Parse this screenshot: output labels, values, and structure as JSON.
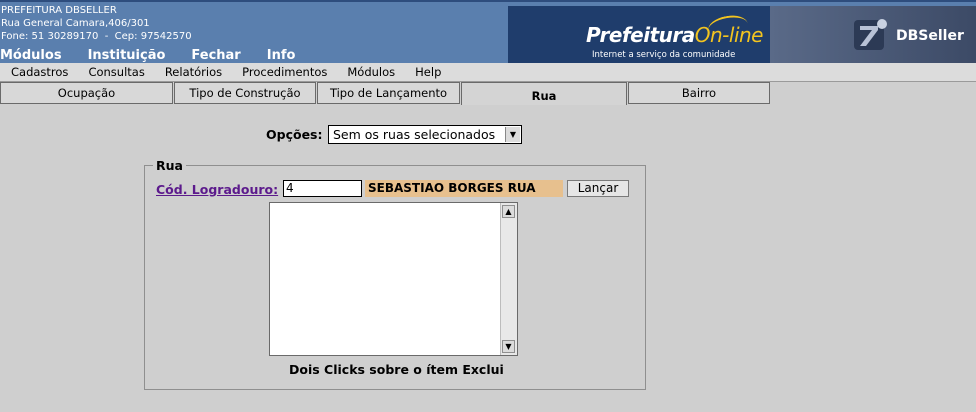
{
  "header": {
    "org_name": "PREFEITURA DBSELLER",
    "address": "Rua General Camara,406/301",
    "contact": "Fone: 51 30289170  -  Cep: 97542570",
    "nav": [
      "Módulos",
      "Instituição",
      "Fechar",
      "Info"
    ],
    "banner_title_1": "Prefeitura",
    "banner_title_2": "On-line",
    "banner_tagline": "Internet a serviço da comunidade",
    "dbseller_brand": "DBSeller"
  },
  "menubar": [
    "Cadastros",
    "Consultas",
    "Relatórios",
    "Procedimentos",
    "Módulos",
    "Help"
  ],
  "tabs": [
    {
      "label": "Ocupação",
      "active": false
    },
    {
      "label": "Tipo de Construção",
      "active": false
    },
    {
      "label": "Tipo de Lançamento",
      "active": false
    },
    {
      "label": "Rua",
      "active": true
    },
    {
      "label": "Bairro",
      "active": false
    }
  ],
  "form": {
    "opcoes_label": "Opções:",
    "opcoes_value": "Sem os ruas selecionados",
    "fieldset_legend": "Rua",
    "cod_label": "Cód. Logradouro:",
    "cod_value": "4",
    "street_name": "SEBASTIAO BORGES RUA",
    "lancar_label": "Lançar",
    "list_items": [],
    "footnote": "Dois Clicks sobre o ítem Exclui"
  },
  "colors": {
    "header_bg": "#5a7fae",
    "banner_bg": "#1f3d6c",
    "accent_yellow": "#f3c41f",
    "street_field_bg": "#e7c08e",
    "link_purple": "#5c1a8c",
    "page_bg": "#cfcfcf"
  }
}
